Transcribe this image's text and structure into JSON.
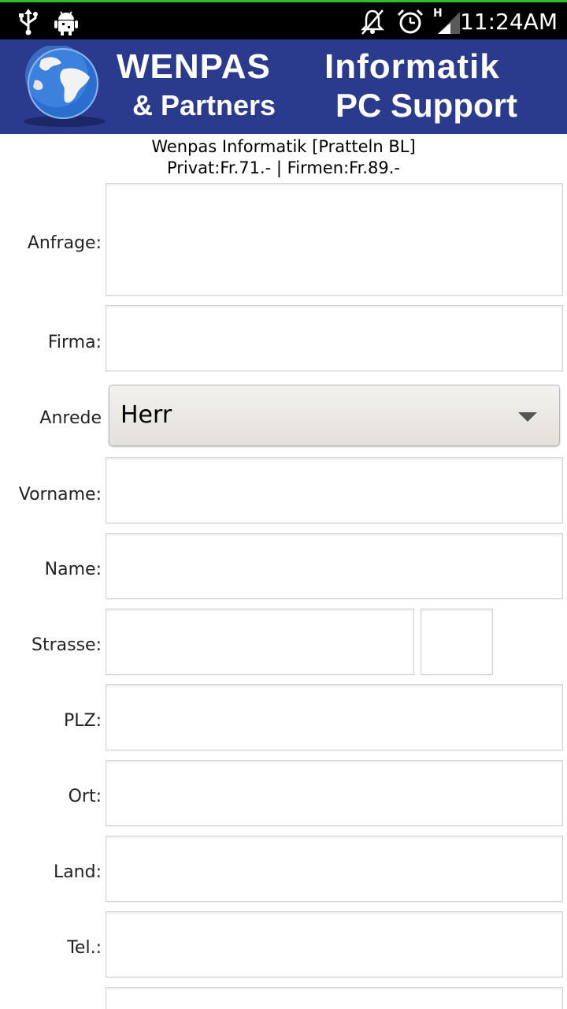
{
  "status_bar": {
    "time": "11:24AM",
    "network_letter": "H",
    "icons": [
      "usb-icon",
      "android-debug-icon",
      "notifications-muted-icon",
      "alarm-icon",
      "signal-icon"
    ]
  },
  "banner": {
    "line1_left": "WENPAS",
    "line1_right": "Informatik",
    "line2_left": "& Partners",
    "line2_right": "PC Support",
    "logo": "globe-icon"
  },
  "header_info": {
    "line1": "Wenpas Informatik [Pratteln BL]",
    "line2": "Privat:Fr.71.- | Firmen:Fr.89.-"
  },
  "form": {
    "anfrage_label": "Anfrage:",
    "firma_label": "Firma:",
    "anrede_label": "Anrede",
    "anrede_value": "Herr",
    "vorname_label": "Vorname:",
    "name_label": "Name:",
    "strasse_label": "Strasse:",
    "plz_label": "PLZ:",
    "ort_label": "Ort:",
    "land_label": "Land:",
    "tel_label": "Tel.:"
  },
  "colors": {
    "status_accent": "#2fbf2f",
    "banner_bg": "#2a3a8c"
  }
}
